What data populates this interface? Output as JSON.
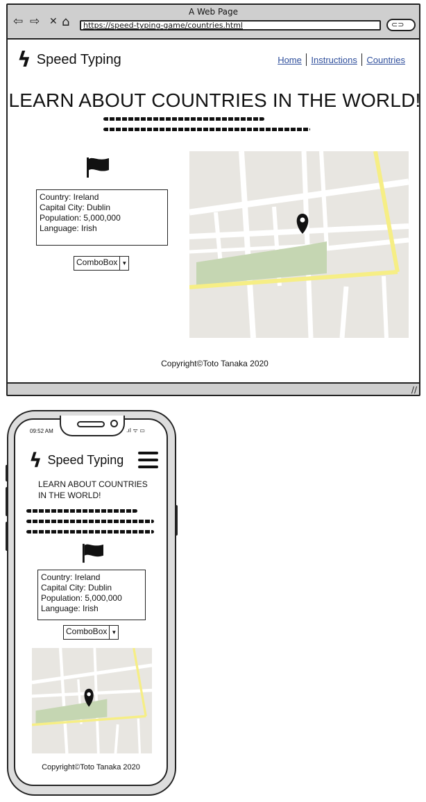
{
  "browser": {
    "window_title": "A Web Page",
    "url": "https://speed-typing-game/countries.html",
    "back_icon": "back-arrow-icon",
    "forward_icon": "forward-arrow-icon",
    "close_icon": "close-icon",
    "home_icon": "home-icon",
    "nav_glyphs": {
      "back": "⇦",
      "forward": "⇨",
      "close": "✕",
      "home": "⌂"
    }
  },
  "site": {
    "logo_text": "Speed Typing",
    "logo_glyph": "ϟ",
    "nav": [
      "Home",
      "Instructions",
      "Countries"
    ],
    "heading": "LEARN ABOUT COUNTRIES IN THE WORLD!",
    "info": {
      "country": "Country: Ireland",
      "capital": "Capital City: Dublin",
      "population": "Population: 5,000,000",
      "language": "Language: Irish"
    },
    "combobox": "ComboBox",
    "footer": "Copyright©Toto Tanaka 2020"
  },
  "phone": {
    "time": "09:52 AM",
    "status_glyphs": ".ıl ᯤ ▭"
  },
  "colors": {
    "chrome": "#cfcfcf",
    "link": "#2f4f9c",
    "map_ground": "#e8e6e1",
    "map_road_major": "#f6ee85",
    "map_park": "#c5d6b2"
  }
}
